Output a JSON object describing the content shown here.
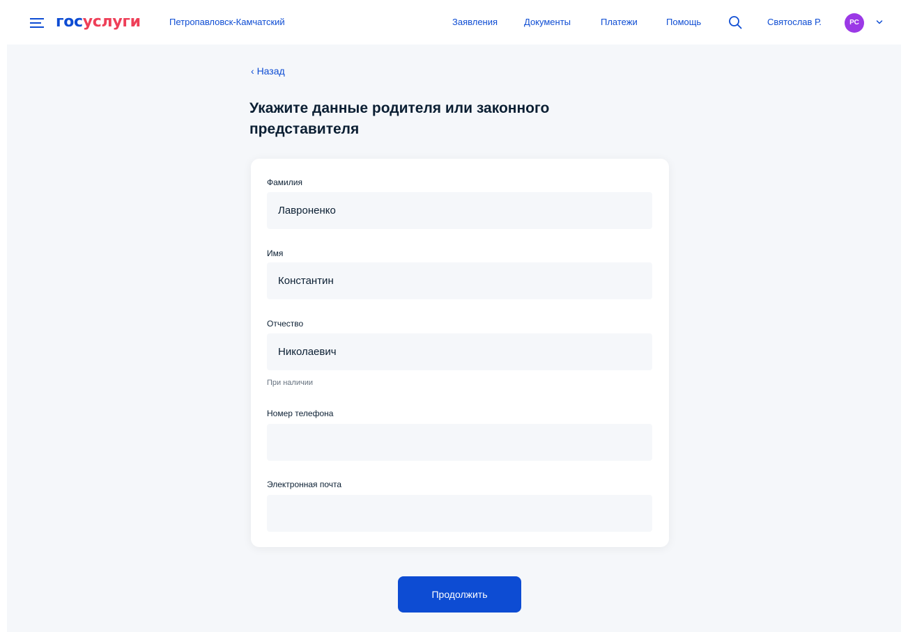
{
  "header": {
    "logo_part1": "гос",
    "logo_part2": "услуги",
    "region": "Петропавловск-Камчатский",
    "nav": [
      "Заявления",
      "Документы",
      "Платежи",
      "Помощь"
    ],
    "user_name": "Святослав Р.",
    "avatar_initials": "РС"
  },
  "back_label": "Назад",
  "title": "Укажите данные родителя или законного представителя",
  "form": {
    "surname": {
      "label": "Фамилия",
      "value": "Лавроненко"
    },
    "name": {
      "label": "Имя",
      "value": "Константин"
    },
    "patronymic": {
      "label": "Отчество",
      "value": "Николаевич",
      "hint": "При наличии"
    },
    "phone": {
      "label": "Номер телефона",
      "value": ""
    },
    "email": {
      "label": "Электронная почта",
      "value": ""
    }
  },
  "continue_label": "Продолжить",
  "colors": {
    "brand_blue": "#0d4cd3",
    "brand_red": "#ee3f58",
    "avatar": "#9b39e6",
    "page_bg": "#f5f7fa"
  }
}
